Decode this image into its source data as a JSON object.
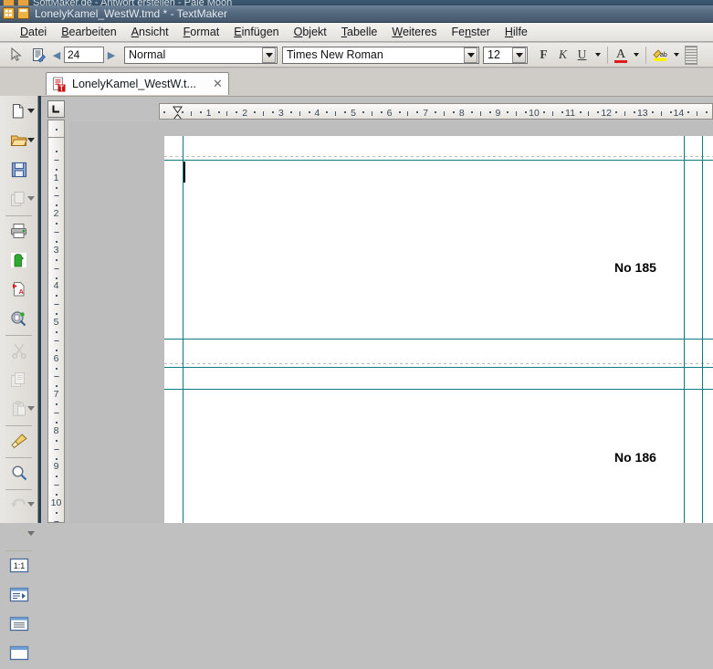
{
  "background_window": {
    "title": "SoftMaker.de - Antwort erstellen - Pale Moon"
  },
  "titlebar": {
    "title": "LonelyKamel_WestW.tmd * - TextMaker"
  },
  "menubar": {
    "items": [
      {
        "label": "Datei",
        "accel": "D"
      },
      {
        "label": "Bearbeiten",
        "accel": "B"
      },
      {
        "label": "Ansicht",
        "accel": "A"
      },
      {
        "label": "Format",
        "accel": "F"
      },
      {
        "label": "Einfügen",
        "accel": "E"
      },
      {
        "label": "Objekt",
        "accel": "O"
      },
      {
        "label": "Tabelle",
        "accel": "T"
      },
      {
        "label": "Weiteres",
        "accel": "W"
      },
      {
        "label": "Fenster",
        "accel": "n"
      },
      {
        "label": "Hilfe",
        "accel": "H"
      }
    ]
  },
  "toolbar": {
    "pointer_icon": "arrow-pointer-icon",
    "edit_mode_icon": "document-edit-icon",
    "prev_label": "◀",
    "next_label": "▶",
    "zoom_value": "24",
    "style_value": "Normal",
    "font_value": "Times New Roman",
    "size_value": "12",
    "bold_label": "F",
    "italic_label": "K",
    "underline_label": "U",
    "font_color_label": "A",
    "highlight_label": "ab"
  },
  "tabs": {
    "items": [
      {
        "label": "LonelyKamel_WestW.t...",
        "icon": "text-document-icon",
        "close": "✕",
        "active": true
      }
    ]
  },
  "left_toolbar": {
    "items": [
      {
        "name": "new-document",
        "icon": "page-icon",
        "dropdown": true,
        "enabled": true
      },
      {
        "name": "open-document",
        "icon": "folder-open-icon",
        "dropdown": true,
        "enabled": true
      },
      {
        "name": "save-document",
        "icon": "floppy-disk-icon",
        "dropdown": false,
        "enabled": true
      },
      {
        "name": "save-all",
        "icon": "multiple-pages-icon",
        "dropdown": true,
        "enabled": false
      },
      {
        "name": "print",
        "icon": "printer-icon",
        "dropdown": false,
        "enabled": true
      },
      {
        "name": "print-preview",
        "icon": "green-figure-icon",
        "dropdown": false,
        "enabled": true
      },
      {
        "name": "export-pdf",
        "icon": "pdf-icon",
        "dropdown": false,
        "enabled": true
      },
      {
        "name": "preview-zoom",
        "icon": "magnifier-page-icon",
        "dropdown": false,
        "enabled": true
      },
      {
        "name": "cut",
        "icon": "scissors-icon",
        "dropdown": false,
        "enabled": false
      },
      {
        "name": "copy",
        "icon": "copy-pages-icon",
        "dropdown": false,
        "enabled": false
      },
      {
        "name": "paste",
        "icon": "clipboard-icon",
        "dropdown": true,
        "enabled": false
      },
      {
        "name": "format-painter",
        "icon": "paintbrush-icon",
        "dropdown": false,
        "enabled": true
      },
      {
        "name": "find",
        "icon": "magnifier-icon",
        "dropdown": false,
        "enabled": true
      },
      {
        "name": "undo",
        "icon": "undo-arrow-icon",
        "dropdown": true,
        "enabled": false
      },
      {
        "name": "redo",
        "icon": "redo-arrow-icon",
        "dropdown": true,
        "enabled": false
      },
      {
        "name": "zoom-100",
        "icon": "one-to-one-icon",
        "dropdown": false,
        "enabled": true,
        "label": "1:1"
      },
      {
        "name": "view-outline",
        "icon": "outline-view-icon",
        "dropdown": false,
        "enabled": true
      },
      {
        "name": "view-page",
        "icon": "page-view-icon",
        "dropdown": false,
        "enabled": true
      },
      {
        "name": "view-master",
        "icon": "master-page-icon",
        "dropdown": false,
        "enabled": true
      }
    ]
  },
  "rulers": {
    "tabstop_icon": "left-tab-stop-icon",
    "horizontal_unit_ticks": [
      "1",
      "2",
      "3",
      "4",
      "5",
      "6",
      "7",
      "8",
      "9",
      "10",
      "11",
      "12",
      "13",
      "14"
    ],
    "vertical_unit_ticks": [
      "1",
      "2",
      "3",
      "4",
      "5",
      "6",
      "7",
      "8",
      "9",
      "10"
    ]
  },
  "document": {
    "page_numbers": [
      {
        "label": "No 185"
      },
      {
        "label": "No 186"
      }
    ],
    "guide_color": "#0c7b7b",
    "page_background": "#ffffff",
    "canvas_background": "#bdbdbd"
  }
}
